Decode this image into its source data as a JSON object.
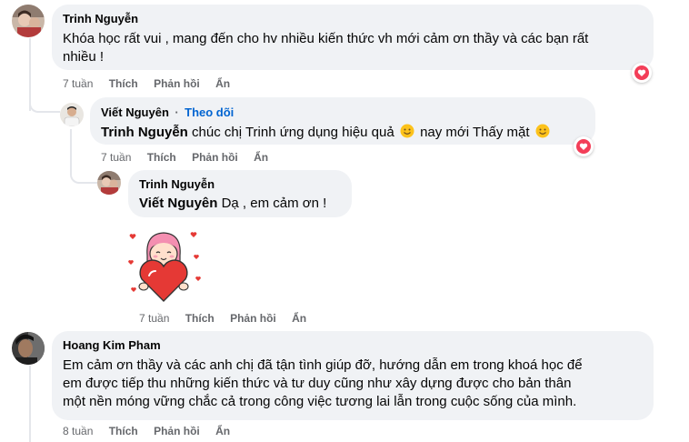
{
  "comments": [
    {
      "author": "Trinh Nguyễn",
      "text": "Khóa học rất vui , mang đến cho hv nhiều kiến thức vh mới cảm ơn thầy và các bạn rất nhiều !",
      "line1": "Khóa học rất vui , mang đến cho hv nhiều kiến thức vh mới cảm ơn thầy và các bạn rất",
      "line2": "nhiều !",
      "time": "7 tuần",
      "like": "Thích",
      "reply": "Phản hồi",
      "hide": "Ẩn",
      "reaction": "heart-reaction"
    },
    {
      "author": "Viết Nguyên",
      "dot": "·",
      "follow": "Theo dõi",
      "mention": "Trinh Nguyễn",
      "text_a": "chúc chị Trinh ứng dụng hiệu quả",
      "text_b": "nay mới Thấy mặt",
      "time": "7 tuần",
      "like": "Thích",
      "reply": "Phản hồi",
      "hide": "Ẩn",
      "reaction": "heart-reaction"
    },
    {
      "author": "Trinh Nguyễn",
      "mention": "Viết Nguyên",
      "text": "Dạ , em cảm ơn !",
      "time": "7 tuần",
      "like": "Thích",
      "reply": "Phản hồi",
      "hide": "Ẩn",
      "sticker": "girl-holding-heart-sticker"
    },
    {
      "author": "Hoang Kim Pham",
      "line1": "Em cảm ơn thầy và các anh chị đã tận tình giúp đỡ, hướng dẫn em trong khoá học để",
      "line2": "em được tiếp thu những kiến thức và tư duy cũng như xây dựng được cho bản thân",
      "line3": "một nền móng vững chắc cả trong công việc tương lai lẫn trong cuộc sống của mình.",
      "time": "8 tuần",
      "like": "Thích",
      "reply": "Phản hồi",
      "hide": "Ẩn"
    }
  ],
  "colors": {
    "bubble": "#f0f2f5",
    "link": "#0064d1",
    "meta": "#65676b",
    "heart": "#f33e58"
  }
}
